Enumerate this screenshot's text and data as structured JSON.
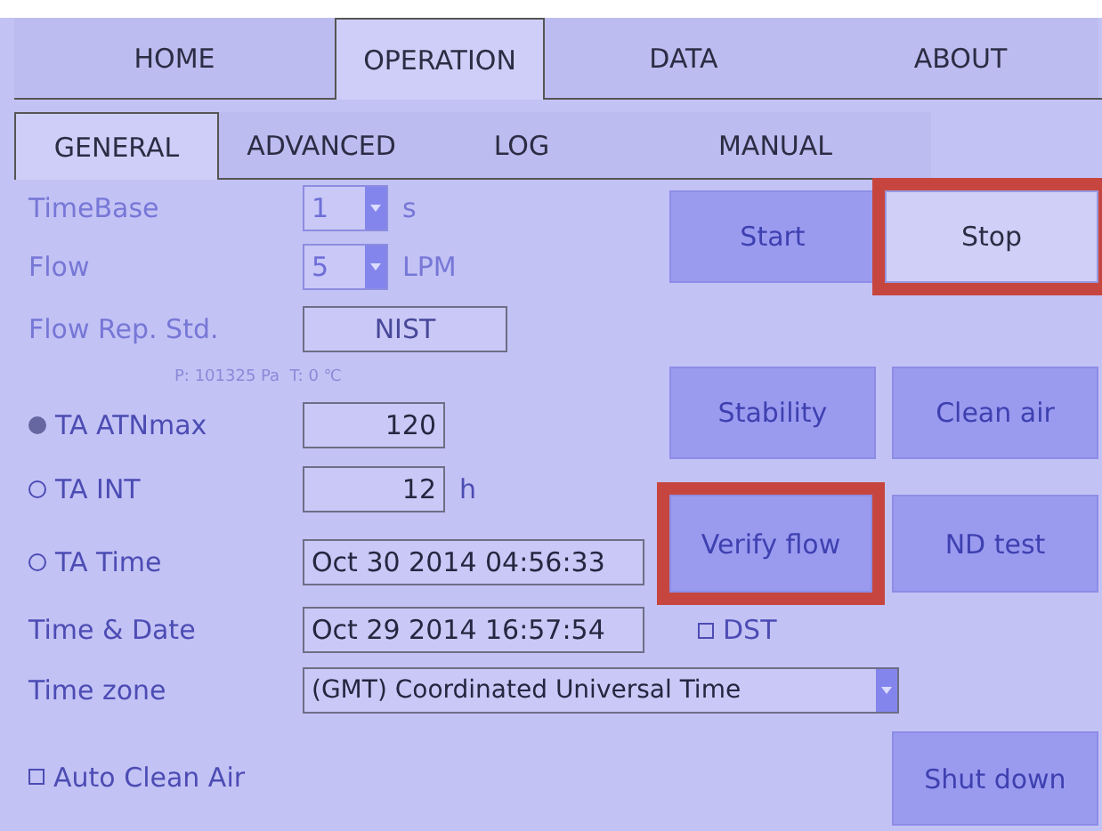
{
  "main_tabs": [
    {
      "label": "HOME",
      "selected": false
    },
    {
      "label": "OPERATION",
      "selected": true
    },
    {
      "label": "DATA",
      "selected": false
    },
    {
      "label": "ABOUT",
      "selected": false
    }
  ],
  "sub_tabs": [
    {
      "label": "GENERAL",
      "selected": true
    },
    {
      "label": "ADVANCED",
      "selected": false
    },
    {
      "label": "LOG",
      "selected": false
    },
    {
      "label": "MANUAL",
      "selected": false
    }
  ],
  "settings": [
    {
      "kind": "select",
      "label": "TimeBase",
      "value": "1",
      "unit": "s",
      "disabled": true
    },
    {
      "kind": "select",
      "label": "Flow",
      "value": "5",
      "unit": "LPM",
      "disabled": true
    },
    {
      "kind": "text",
      "label": "Flow Rep. Std.",
      "value": "NIST",
      "disabled": true,
      "note": "P: 101325 Pa  T: 0 ℃"
    },
    {
      "kind": "radio",
      "label": "TA ATNmax",
      "value": "120",
      "selected": true
    },
    {
      "kind": "radio",
      "label": "TA INT",
      "value": "12",
      "unit": "h",
      "selected": false
    },
    {
      "kind": "radio",
      "label": "TA Time",
      "value": "Oct 30 2014 04:56:33",
      "selected": false
    },
    {
      "kind": "text",
      "label": "Time & Date",
      "value": "Oct 29 2014 16:57:54",
      "checkbox": {
        "label": "DST",
        "checked": false
      }
    },
    {
      "kind": "select",
      "label": "Time zone",
      "value": "(GMT) Coordinated Universal Time"
    },
    {
      "kind": "checkbox",
      "label": "Auto Clean Air",
      "checked": false
    }
  ],
  "buttons": [
    {
      "label": "Start",
      "disabled": true,
      "highlighted": false
    },
    {
      "label": "Stop",
      "disabled": false,
      "highlighted": true
    },
    {
      "label": "Stability",
      "disabled": true,
      "highlighted": false
    },
    {
      "label": "Clean air",
      "disabled": true,
      "highlighted": false
    },
    {
      "label": "Verify flow",
      "disabled": true,
      "highlighted": true
    },
    {
      "label": "ND test",
      "disabled": true,
      "highlighted": false
    },
    {
      "label": "Shut down",
      "disabled": true,
      "highlighted": false
    }
  ]
}
